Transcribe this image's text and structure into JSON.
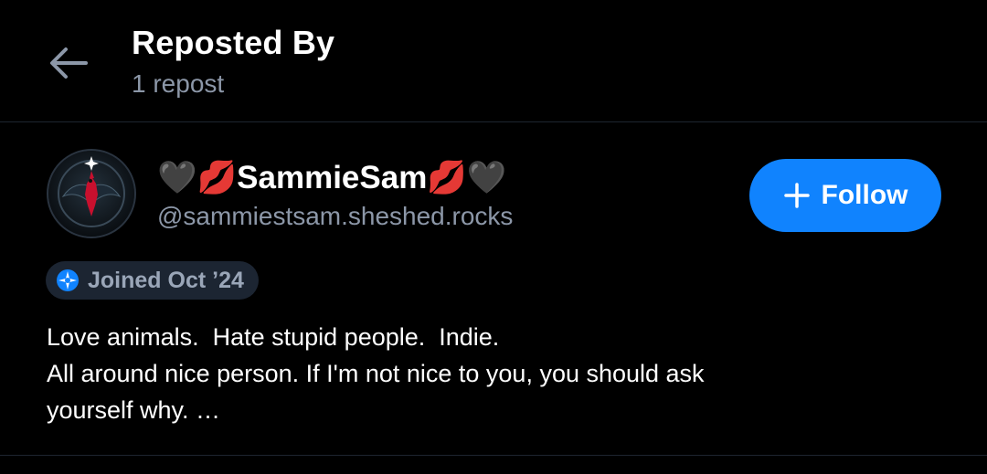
{
  "header": {
    "title": "Reposted By",
    "subtitle": "1 repost"
  },
  "user": {
    "display_name": "🖤💋SammieSam💋🖤",
    "handle": "@sammiestsam.sheshed.rocks",
    "follow_label": "Follow",
    "joined_label": "Joined Oct ’24",
    "bio_lines": [
      "Love animals.  Hate stupid people.  Indie.",
      "All around nice person. If I'm not nice to you, you should ask",
      "yourself why. …"
    ]
  },
  "icons": {
    "back": "arrow-left-icon",
    "follow": "plus-icon",
    "joined": "sparkle-badge-icon",
    "avatar": "cardinal-emblem-avatar"
  },
  "colors": {
    "background": "#000000",
    "accent": "#1083fe",
    "muted_text": "#8c97a8",
    "divider": "#1e2530",
    "badge_bg": "#1c2532"
  }
}
